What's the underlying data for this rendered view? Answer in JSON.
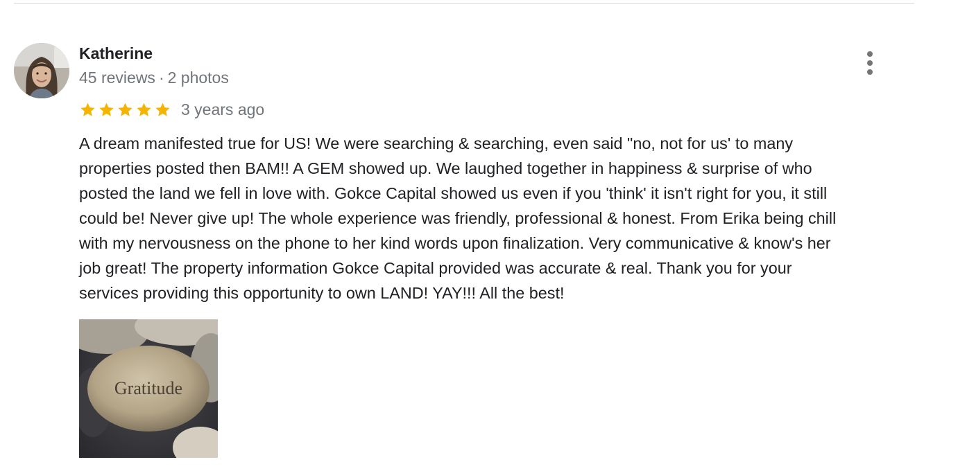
{
  "review": {
    "reviewer": {
      "name": "Katherine",
      "review_count": "45 reviews",
      "separator": "·",
      "photo_count": "2 photos"
    },
    "rating": {
      "stars": 5,
      "max_stars": 5,
      "star_color": "#f4b400",
      "date": "3 years ago"
    },
    "text_lines": [
      "A dream manifested true for US! We were searching & searching, even said \"no, not for us' to many",
      "properties posted then BAM!! A GEM showed up. We laughed together in happiness & surprise of who",
      "posted the land we fell in love with. Gokce Capital showed us even if you 'think' it isn't right for you, it still",
      "could be! Never give up! The whole experience was friendly, professional & honest. From Erika being chill",
      "with my nervousness on the phone to her kind words upon finalization. Very communicative & know's her",
      "job great! The property information Gokce Capital provided was accurate & real. Thank you for your",
      "services providing this opportunity to own LAND! YAY!!! All the best!"
    ],
    "photo": {
      "engraved_text": "Gratitude"
    }
  },
  "icons": {
    "more": "more-vert-icon",
    "star": "star-icon"
  }
}
